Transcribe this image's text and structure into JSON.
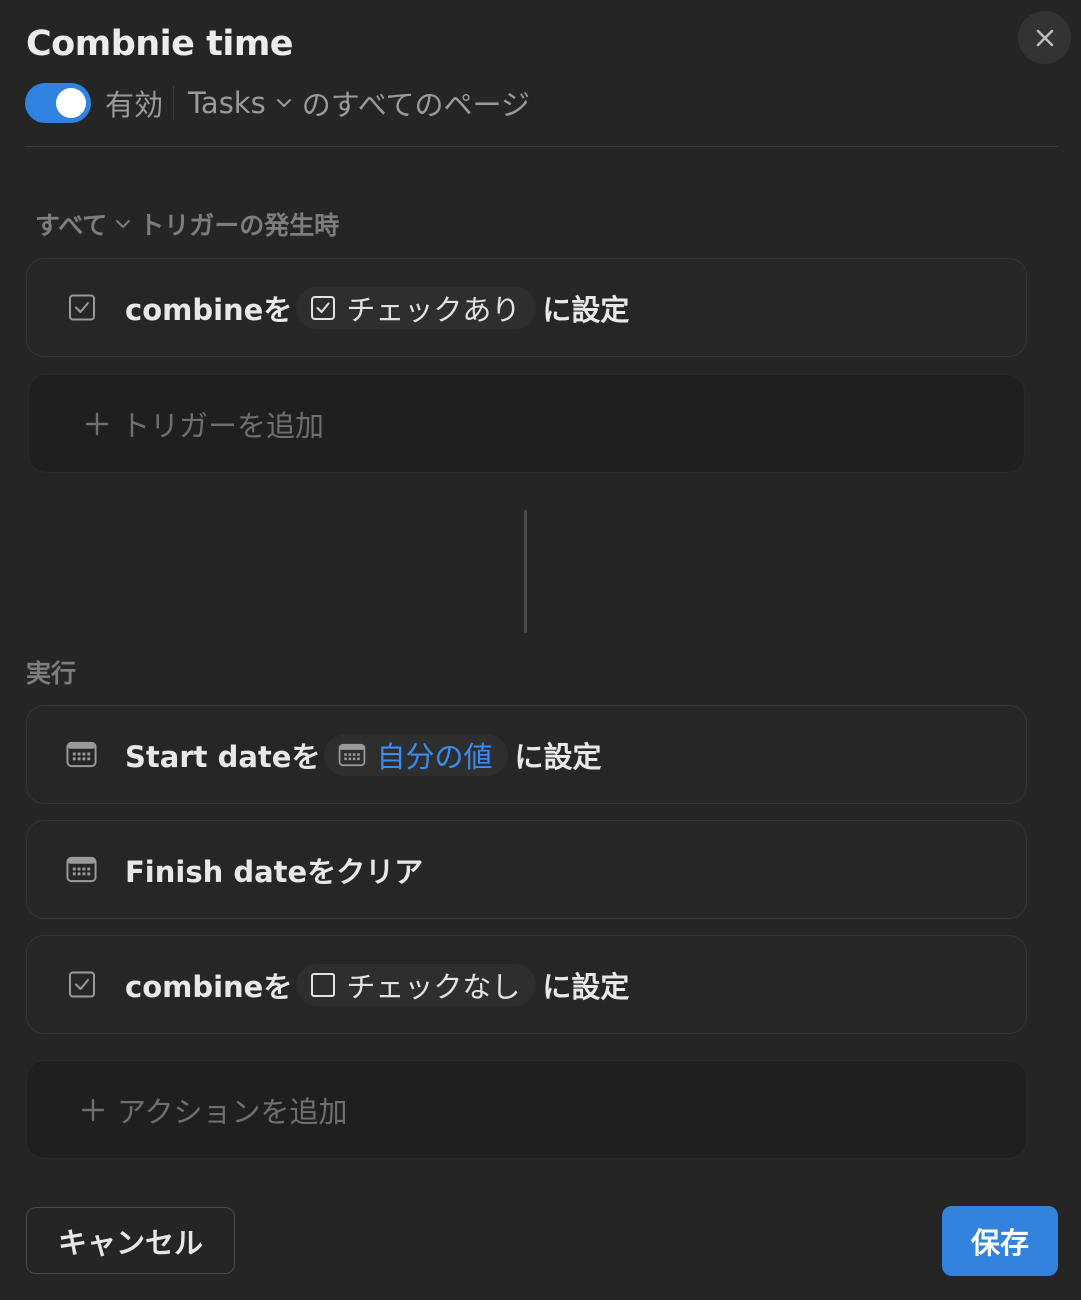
{
  "header": {
    "title": "Combnie time",
    "close_icon": "close-icon"
  },
  "status": {
    "enabled": true,
    "enabled_label": "有効",
    "database": "Tasks",
    "scope_label": "のすべてのページ"
  },
  "triggers": {
    "match_mode": "すべて",
    "header_suffix": "トリガーの発生時",
    "items": [
      {
        "icon": "checkbox-icon",
        "prefix": "combineを",
        "pill_icon": "checkbox-checked-icon",
        "pill_label": "チェックあり",
        "suffix": "に設定"
      }
    ],
    "add_label": "トリガーを追加"
  },
  "actions": {
    "header": "実行",
    "items": [
      {
        "icon": "calendar-icon",
        "prefix": "Start dateを",
        "pill_icon": "calendar-icon",
        "pill_label": "自分の値",
        "suffix": "に設定"
      },
      {
        "icon": "calendar-icon",
        "text": "Finish dateをクリア"
      },
      {
        "icon": "checkbox-icon",
        "prefix": "combineを",
        "pill_icon": "checkbox-empty-icon",
        "pill_label": "チェックなし",
        "suffix": "に設定"
      }
    ],
    "add_label": "アクションを追加"
  },
  "footer": {
    "cancel_label": "キャンセル",
    "save_label": "保存"
  },
  "colors": {
    "background": "#252525",
    "accent": "#2f82e0",
    "link_blue": "#3b8cf0"
  }
}
